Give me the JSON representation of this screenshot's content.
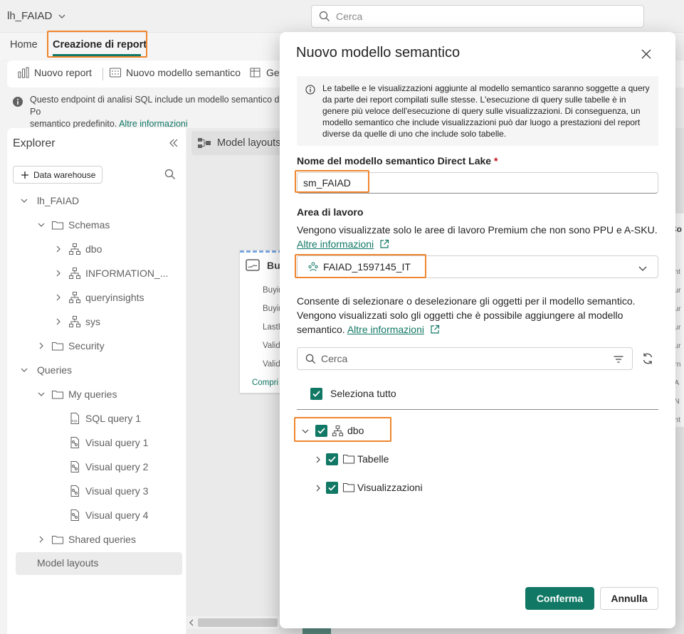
{
  "topbar": {
    "workspace": "lh_FAIAD",
    "search_placeholder": "Cerca"
  },
  "tabs": [
    {
      "label": "Home"
    },
    {
      "label": "Creazione di report"
    }
  ],
  "toolbar": {
    "new_report": "Nuovo report",
    "new_semantic_model": "Nuovo modello semantico",
    "partial_next": "Ge"
  },
  "info_banner": {
    "line1": "Questo endpoint di analisi SQL include un modello semantico di Po",
    "line2": "semantico predefinito.",
    "link": "Altre informazioni"
  },
  "explorer": {
    "title": "Explorer",
    "add_button": "Data warehouse",
    "tree": {
      "root": "lh_FAIAD",
      "schemas": "Schemas",
      "schema_items": [
        "dbo",
        "INFORMATION_...",
        "queryinsights",
        "sys"
      ],
      "security": "Security",
      "queries": "Queries",
      "my_queries": "My queries",
      "query_items": [
        "SQL query 1",
        "Visual query 1",
        "Visual query 2",
        "Visual query 3",
        "Visual query 4"
      ],
      "shared_queries": "Shared queries",
      "model_layouts": "Model layouts"
    }
  },
  "canvas": {
    "tab_label": "Model layouts",
    "card_title": "Buy",
    "card_rows": [
      "Buyin",
      "Buyin",
      "LastE",
      "Valid",
      "Valid"
    ],
    "card_footer": "Compri",
    "right_strip": [
      "Co",
      "ont",
      "our",
      "our",
      "our",
      "our",
      "orn",
      "oA",
      "oN",
      "ont",
      "ro"
    ]
  },
  "modal": {
    "title": "Nuovo modello semantico",
    "notice": "Le tabelle e le visualizzazioni aggiunte al modello semantico saranno soggette a query da parte dei report compilati sulle stesse. L'esecuzione di query sulle tabelle è in genere più veloce dell'esecuzione di query sulle visualizzazioni. Di conseguenza, un modello semantico che include visualizzazioni può dar luogo a prestazioni del report diverse da quelle di uno che include solo tabelle.",
    "name_label": "Nome del modello semantico Direct Lake",
    "required_mark": "*",
    "name_value": "sm_FAIAD",
    "workspace_label": "Area di lavoro",
    "workspace_hint": "Vengono visualizzate solo le aree di lavoro Premium che non sono PPU e A-SKU.",
    "workspace_link": "Altre informazioni",
    "workspace_value": "FAIAD_1597145_IT",
    "objects_hint": "Consente di selezionare o deselezionare gli oggetti per il modello semantico. Vengono visualizzati solo gli oggetti che è possibile aggiungere al modello semantico.",
    "objects_link": "Altre informazioni",
    "search_placeholder": "Cerca",
    "select_all": "Seleziona tutto",
    "tree": {
      "schema": "dbo",
      "children": [
        "Tabelle",
        "Visualizzazioni"
      ]
    },
    "confirm": "Conferma",
    "cancel": "Annulla"
  },
  "colors": {
    "accent": "#117865",
    "highlight": "#f0862d"
  }
}
